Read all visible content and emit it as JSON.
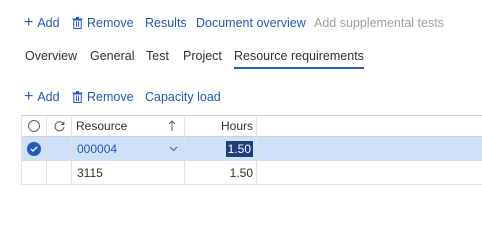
{
  "action_bar": {
    "add_label": "Add",
    "remove_label": "Remove",
    "results_label": "Results",
    "document_overview_label": "Document overview",
    "add_supplemental_tests_label": "Add supplemental tests"
  },
  "tabs": [
    {
      "label": "Overview",
      "active": false
    },
    {
      "label": "General",
      "active": false
    },
    {
      "label": "Test",
      "active": false
    },
    {
      "label": "Project",
      "active": false
    },
    {
      "label": "Resource requirements",
      "active": true
    }
  ],
  "grid_toolbar": {
    "add_label": "Add",
    "remove_label": "Remove",
    "capacity_load_label": "Capacity load"
  },
  "grid": {
    "columns": {
      "resource": "Resource",
      "hours": "Hours"
    },
    "rows": [
      {
        "resource": "000004",
        "hours": "1.50",
        "selected": true
      },
      {
        "resource": "3115",
        "hours": "1.50",
        "selected": false
      }
    ]
  },
  "colors": {
    "accent": "#2359b8",
    "selected_row": "#cfe0f8",
    "disabled_text": "#a19f9d"
  }
}
